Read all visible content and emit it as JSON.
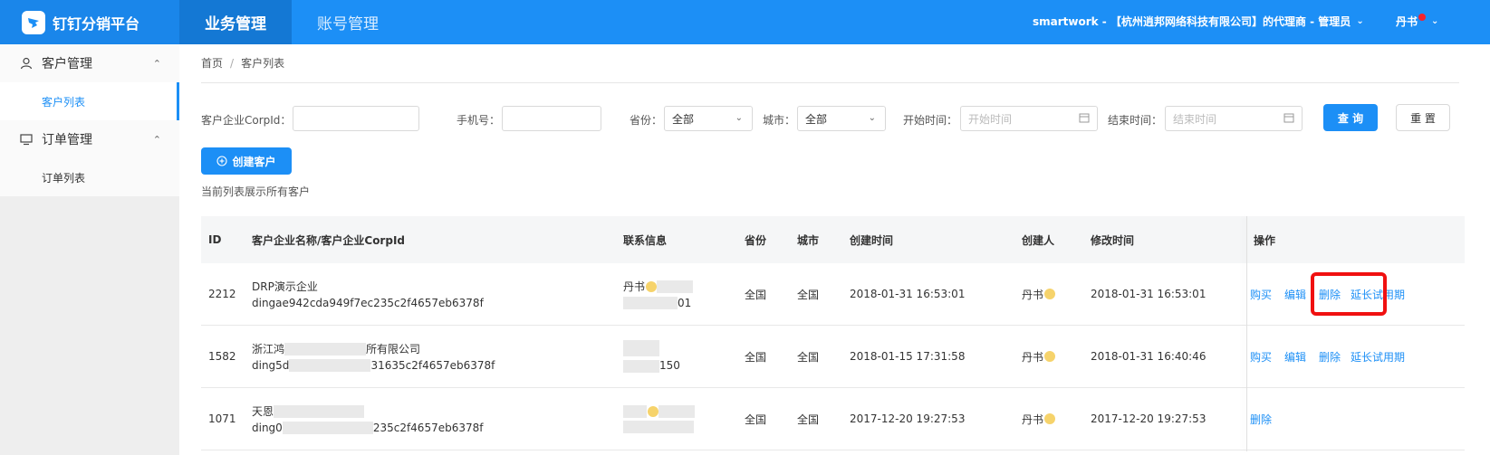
{
  "header": {
    "brand_title": "钉钉分销平台",
    "nav": [
      {
        "label": "业务管理",
        "active": true
      },
      {
        "label": "账号管理",
        "active": false
      }
    ],
    "org_text": "smartwork - 【杭州逍邦网络科技有限公司】的代理商 - 管理员",
    "user_name": "丹书",
    "colors": {
      "primary": "#1c8ff6",
      "active_nav": "#1478d4"
    }
  },
  "sidebar": {
    "groups": [
      {
        "label": "客户管理",
        "icon": "user-icon",
        "items": [
          {
            "label": "客户列表",
            "active": true
          }
        ]
      },
      {
        "label": "订单管理",
        "icon": "monitor-icon",
        "items": [
          {
            "label": "订单列表",
            "active": false
          }
        ]
      }
    ]
  },
  "breadcrumb": {
    "home": "首页",
    "sep": "/",
    "current": "客户列表"
  },
  "filters": {
    "corpid_label": "客户企业CorpId：",
    "phone_label": "手机号：",
    "province_label": "省份：",
    "province_value": "全部",
    "city_label": "城市：",
    "city_value": "全部",
    "start_label": "开始时间：",
    "start_placeholder": "开始时间",
    "end_label": "结束时间：",
    "end_placeholder": "结束时间",
    "query_button": "查 询",
    "reset_button": "重 置"
  },
  "create_button": "创建客户",
  "hint": "当前列表展示所有客户",
  "table": {
    "columns": [
      "ID",
      "客户企业名称/客户企业CorpId",
      "联系信息",
      "省份",
      "城市",
      "创建时间",
      "创建人",
      "修改时间",
      "操作"
    ],
    "rows": [
      {
        "id": "2212",
        "name": "DRP演示企业",
        "corpid": "dingae942cda949f7ec235c2f4657eb6378f",
        "contact1": "丹书",
        "contact2": "01",
        "province": "全国",
        "city": "全国",
        "created": "2018-01-31 16:53:01",
        "creator": "丹书",
        "modified": "2018-01-31 16:53:01",
        "ops": [
          "购买",
          "编辑",
          "删除",
          "延长试用期"
        ]
      },
      {
        "id": "1582",
        "name_pre": "浙江鸿",
        "name_post": "所有限公司",
        "corpid_pre": "ding5d",
        "corpid_post": "31635c2f4657eb6378f",
        "contact2": "150",
        "province": "全国",
        "city": "全国",
        "created": "2018-01-15 17:31:58",
        "creator": "丹书",
        "modified": "2018-01-31 16:40:46",
        "ops": [
          "购买",
          "编辑",
          "删除",
          "延长试用期"
        ]
      },
      {
        "id": "1071",
        "name_pre": "天恩",
        "corpid_pre": "ding0",
        "corpid_post": "235c2f4657eb6378f",
        "province": "全国",
        "city": "全国",
        "created": "2017-12-20 19:27:53",
        "creator": "丹书",
        "modified": "2017-12-20 19:27:53",
        "ops": [
          "删除"
        ]
      }
    ]
  }
}
